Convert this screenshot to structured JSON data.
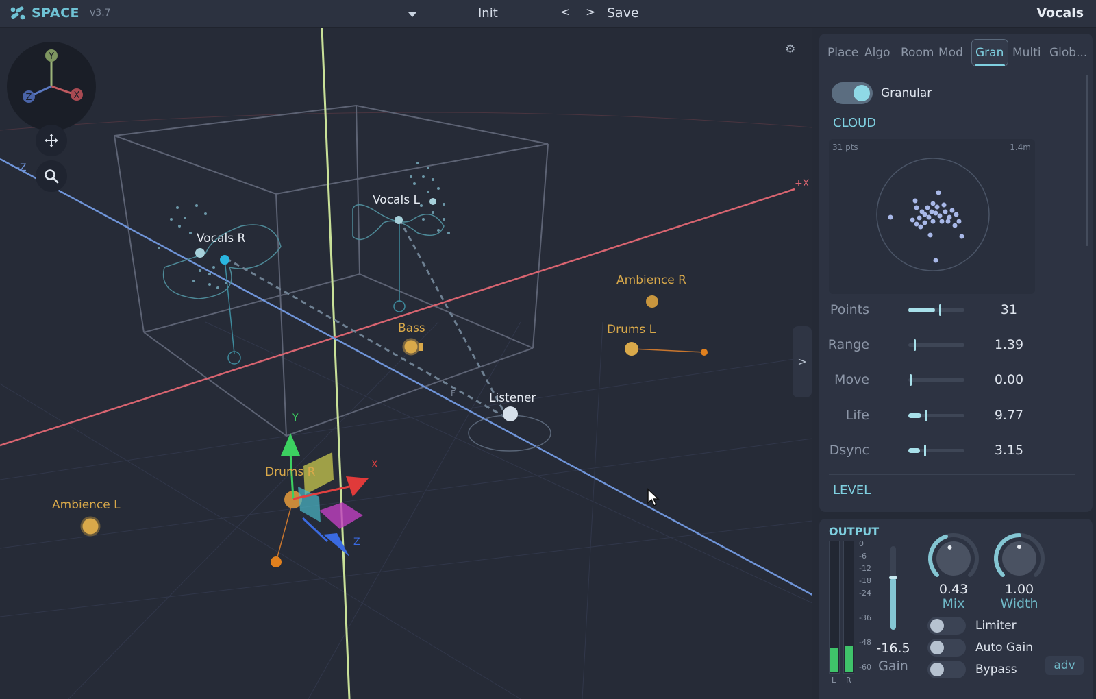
{
  "app": {
    "brand": "SPACE",
    "version": "v3.7",
    "preset": "Init",
    "nav_prev": "<",
    "nav_next": ">",
    "save_label": "Save",
    "selected_source": "Vocals",
    "dropdown_icon": "chevron-down-icon",
    "accent_color": "#7fd0e0"
  },
  "viewport": {
    "gizmo_axes": [
      "Y",
      "X",
      "Z"
    ],
    "axis_labels": {
      "neg_z": "-Z",
      "pos_x": "+X"
    },
    "move_tool_icon": "move-icon",
    "zoom_tool_icon": "search-icon",
    "settings_icon": "gear-icon",
    "expand_label": ">",
    "sources": [
      {
        "name": "Vocals L",
        "group": "selected"
      },
      {
        "name": "Vocals R",
        "group": "selected"
      },
      {
        "name": "Ambience R",
        "group": "other"
      },
      {
        "name": "Bass",
        "group": "other"
      },
      {
        "name": "Drums L",
        "group": "other"
      },
      {
        "name": "Listener",
        "group": "listener"
      },
      {
        "name": "Drums R",
        "group": "other"
      },
      {
        "name": "Ambience L",
        "group": "other"
      }
    ],
    "listener_front_mark": "F",
    "transform_gizmo_axes": [
      "Y",
      "X",
      "Z"
    ],
    "colors": {
      "selected": "#6fc8e0",
      "other": "#d9a94a",
      "x_axis": "#e06070",
      "z_axis": "#6f94d8",
      "y_axis": "#c8e098"
    }
  },
  "panel": {
    "tabs": [
      "Place",
      "Algo",
      "Room",
      "Mod",
      "Gran",
      "Multi",
      "Glob..."
    ],
    "active_tab": "Gran",
    "granular_toggle_label": "Granular",
    "granular_on": true,
    "cloud_title": "CLOUD",
    "cloud_points": "31 pts",
    "cloud_radius": "1.4m",
    "params": [
      {
        "label": "Points",
        "value": "31",
        "fraction": 0.55
      },
      {
        "label": "Range",
        "value": "1.39",
        "fraction": 0.1
      },
      {
        "label": "Move",
        "value": "0.00",
        "fraction": 0.03
      },
      {
        "label": "Life",
        "value": "9.77",
        "fraction": 0.3
      },
      {
        "label": "Dsync",
        "value": "3.15",
        "fraction": 0.28
      }
    ],
    "level_title": "LEVEL"
  },
  "output": {
    "title": "OUTPUT",
    "meter_scale": [
      "0",
      "-6",
      "-12",
      "-18",
      "-24",
      "-36",
      "-48",
      "-60"
    ],
    "meter_channels": [
      "L",
      "R"
    ],
    "meter_levels": [
      0.18,
      0.2
    ],
    "gain_value": "-16.5",
    "gain_label": "Gain",
    "gain_fraction": 0.62,
    "mix_value": "0.43",
    "mix_label": "Mix",
    "mix_fraction": 0.43,
    "width_value": "1.00",
    "width_label": "Width",
    "width_fraction": 0.5,
    "toggles": [
      "Limiter",
      "Auto Gain",
      "Bypass"
    ],
    "adv_label": "adv"
  }
}
